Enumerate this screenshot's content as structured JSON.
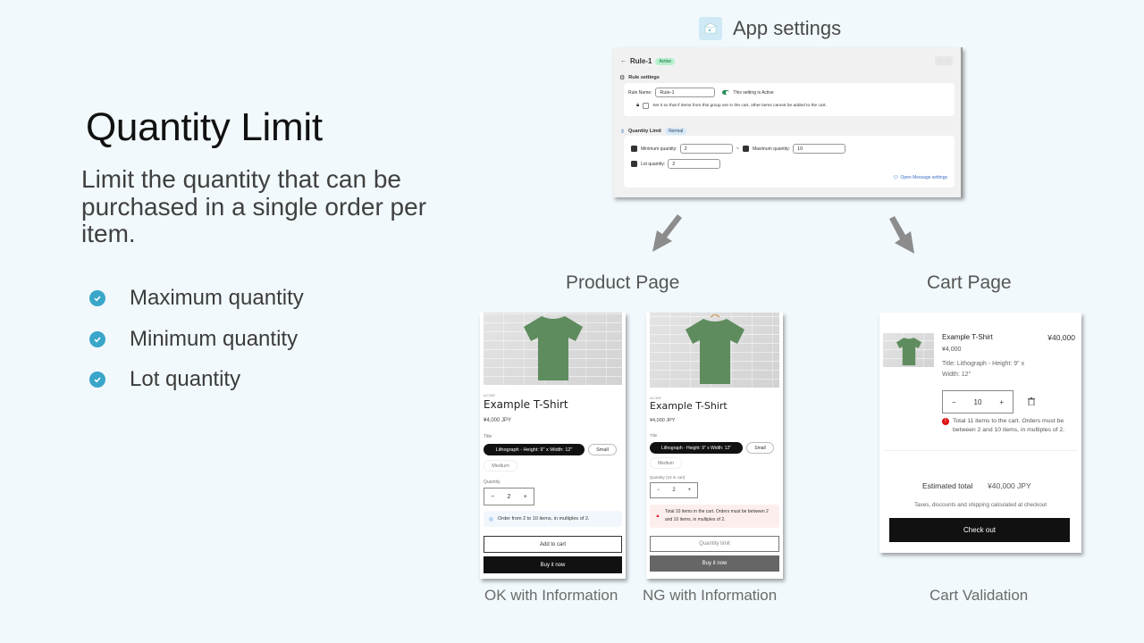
{
  "hero": {
    "title": "Quantity Limit",
    "description": "Limit the quantity that can be purchased in a single order per item.",
    "features": [
      "Maximum quantity",
      "Minimum quantity",
      "Lot quantity"
    ],
    "check_icon": "check-circle-icon",
    "accent_color": "#3aa6c9"
  },
  "app_settings": {
    "heading": "App settings",
    "icon": "app-box-icon",
    "rule_title": "Rule-1",
    "rule_status": "Active",
    "rule_settings_label": "Rule settings",
    "rule_name_label": "Rule Name:",
    "rule_name_value": "Rule-1",
    "toggle_label": "This setting is Active",
    "exclusive_label": "Set it so that if items from this group are in the cart, other items cannot be added to the cart.",
    "quantity_limit_label": "Quantity Limit",
    "quantity_limit_badge": "Normal",
    "min_label": "Minimum quantity:",
    "min_value": "2",
    "separator": "~",
    "max_label": "Maximum quantity:",
    "max_value": "10",
    "lot_label": "Lot quantity:",
    "lot_value": "2",
    "message_link": "Open Message settings",
    "prev_icon": "chevron-left-icon",
    "next_icon": "chevron-right-icon"
  },
  "sections": {
    "product_page": "Product Page",
    "cart_page": "Cart Page"
  },
  "product_ok": {
    "caption": "OK with Information",
    "vendor": "ACME",
    "name": "Example T-Shirt",
    "price": "¥4,000 JPY",
    "title_label": "Title",
    "variants": [
      "Lithograph - Height: 9\" x Width: 12\"",
      "Small",
      "Medium"
    ],
    "quantity_label": "Quantity",
    "quantity": "2",
    "minus": "−",
    "plus": "+",
    "info": "Order from 2 to 10 items, in multiples of 2.",
    "add_to_cart": "Add to cart",
    "buy_now": "Buy it now"
  },
  "product_ng": {
    "caption": "NG with Information",
    "vendor": "ACME",
    "name": "Example T-Shirt",
    "price": "¥4,000 JPY",
    "title_label": "Title",
    "variants": [
      "Lithograph - Height: 9\" x Width: 12\"",
      "Small",
      "Medium"
    ],
    "quantity_label": "Quantity (10 in cart)",
    "quantity": "2",
    "minus": "−",
    "plus": "+",
    "warning": "Total 10 items in the cart. Orders must be between 2 and 10 items, in multiples of 2.",
    "quantity_limit_btn": "Quantity limit",
    "buy_now": "Buy it now"
  },
  "cart": {
    "caption": "Cart Validation",
    "item_name": "Example T-Shirt",
    "item_line_total": "¥40,000",
    "unit_price": "¥4,000",
    "variant": "Title: Lithograph - Height: 9\" x Width: 12\"",
    "quantity": "10",
    "minus": "−",
    "plus": "+",
    "error": "Total 11 items to the cart. Orders must be between 2 and 10 items, in multiples of 2.",
    "estimated_label": "Estimated total",
    "estimated_value": "¥40,000 JPY",
    "tax_note": "Taxes, discounts and shipping calculated at checkout",
    "checkout": "Check out"
  }
}
